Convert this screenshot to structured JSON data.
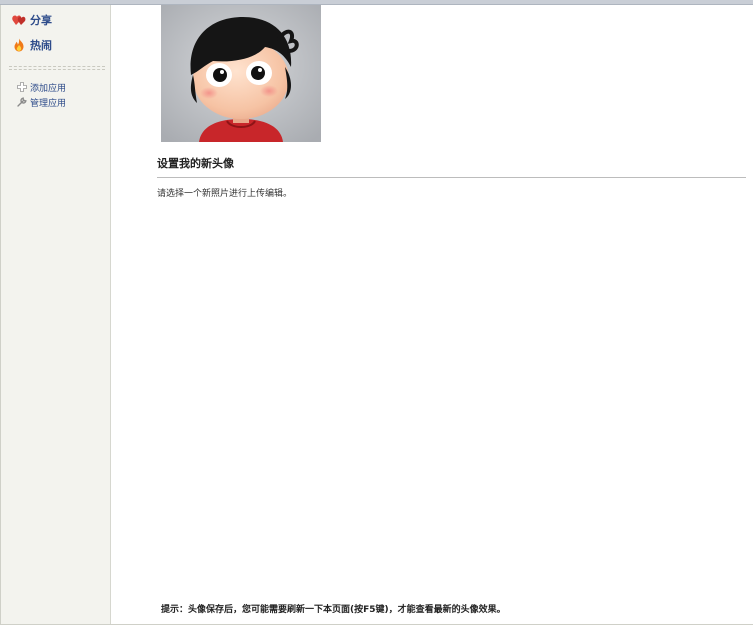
{
  "sidebar": {
    "nav": [
      {
        "label": "分享",
        "icon": "hearts-icon"
      },
      {
        "label": "热闹",
        "icon": "flame-icon"
      }
    ],
    "apps": [
      {
        "label": "添加应用",
        "icon": "plus-icon"
      },
      {
        "label": "管理应用",
        "icon": "wrench-icon"
      }
    ]
  },
  "main": {
    "avatar_alt": "cartoon-avatar",
    "title": "设置我的新头像",
    "instruction": "请选择一个新照片进行上传编辑。",
    "tip": "提示：头像保存后，您可能需要刷新一下本页面(按F5键)，才能查看最新的头像效果。"
  },
  "colors": {
    "link": "#2d4b8a",
    "sidebar_bg": "#f3f3ee",
    "heart": "#d9443b",
    "flame": "#f08a1c"
  }
}
